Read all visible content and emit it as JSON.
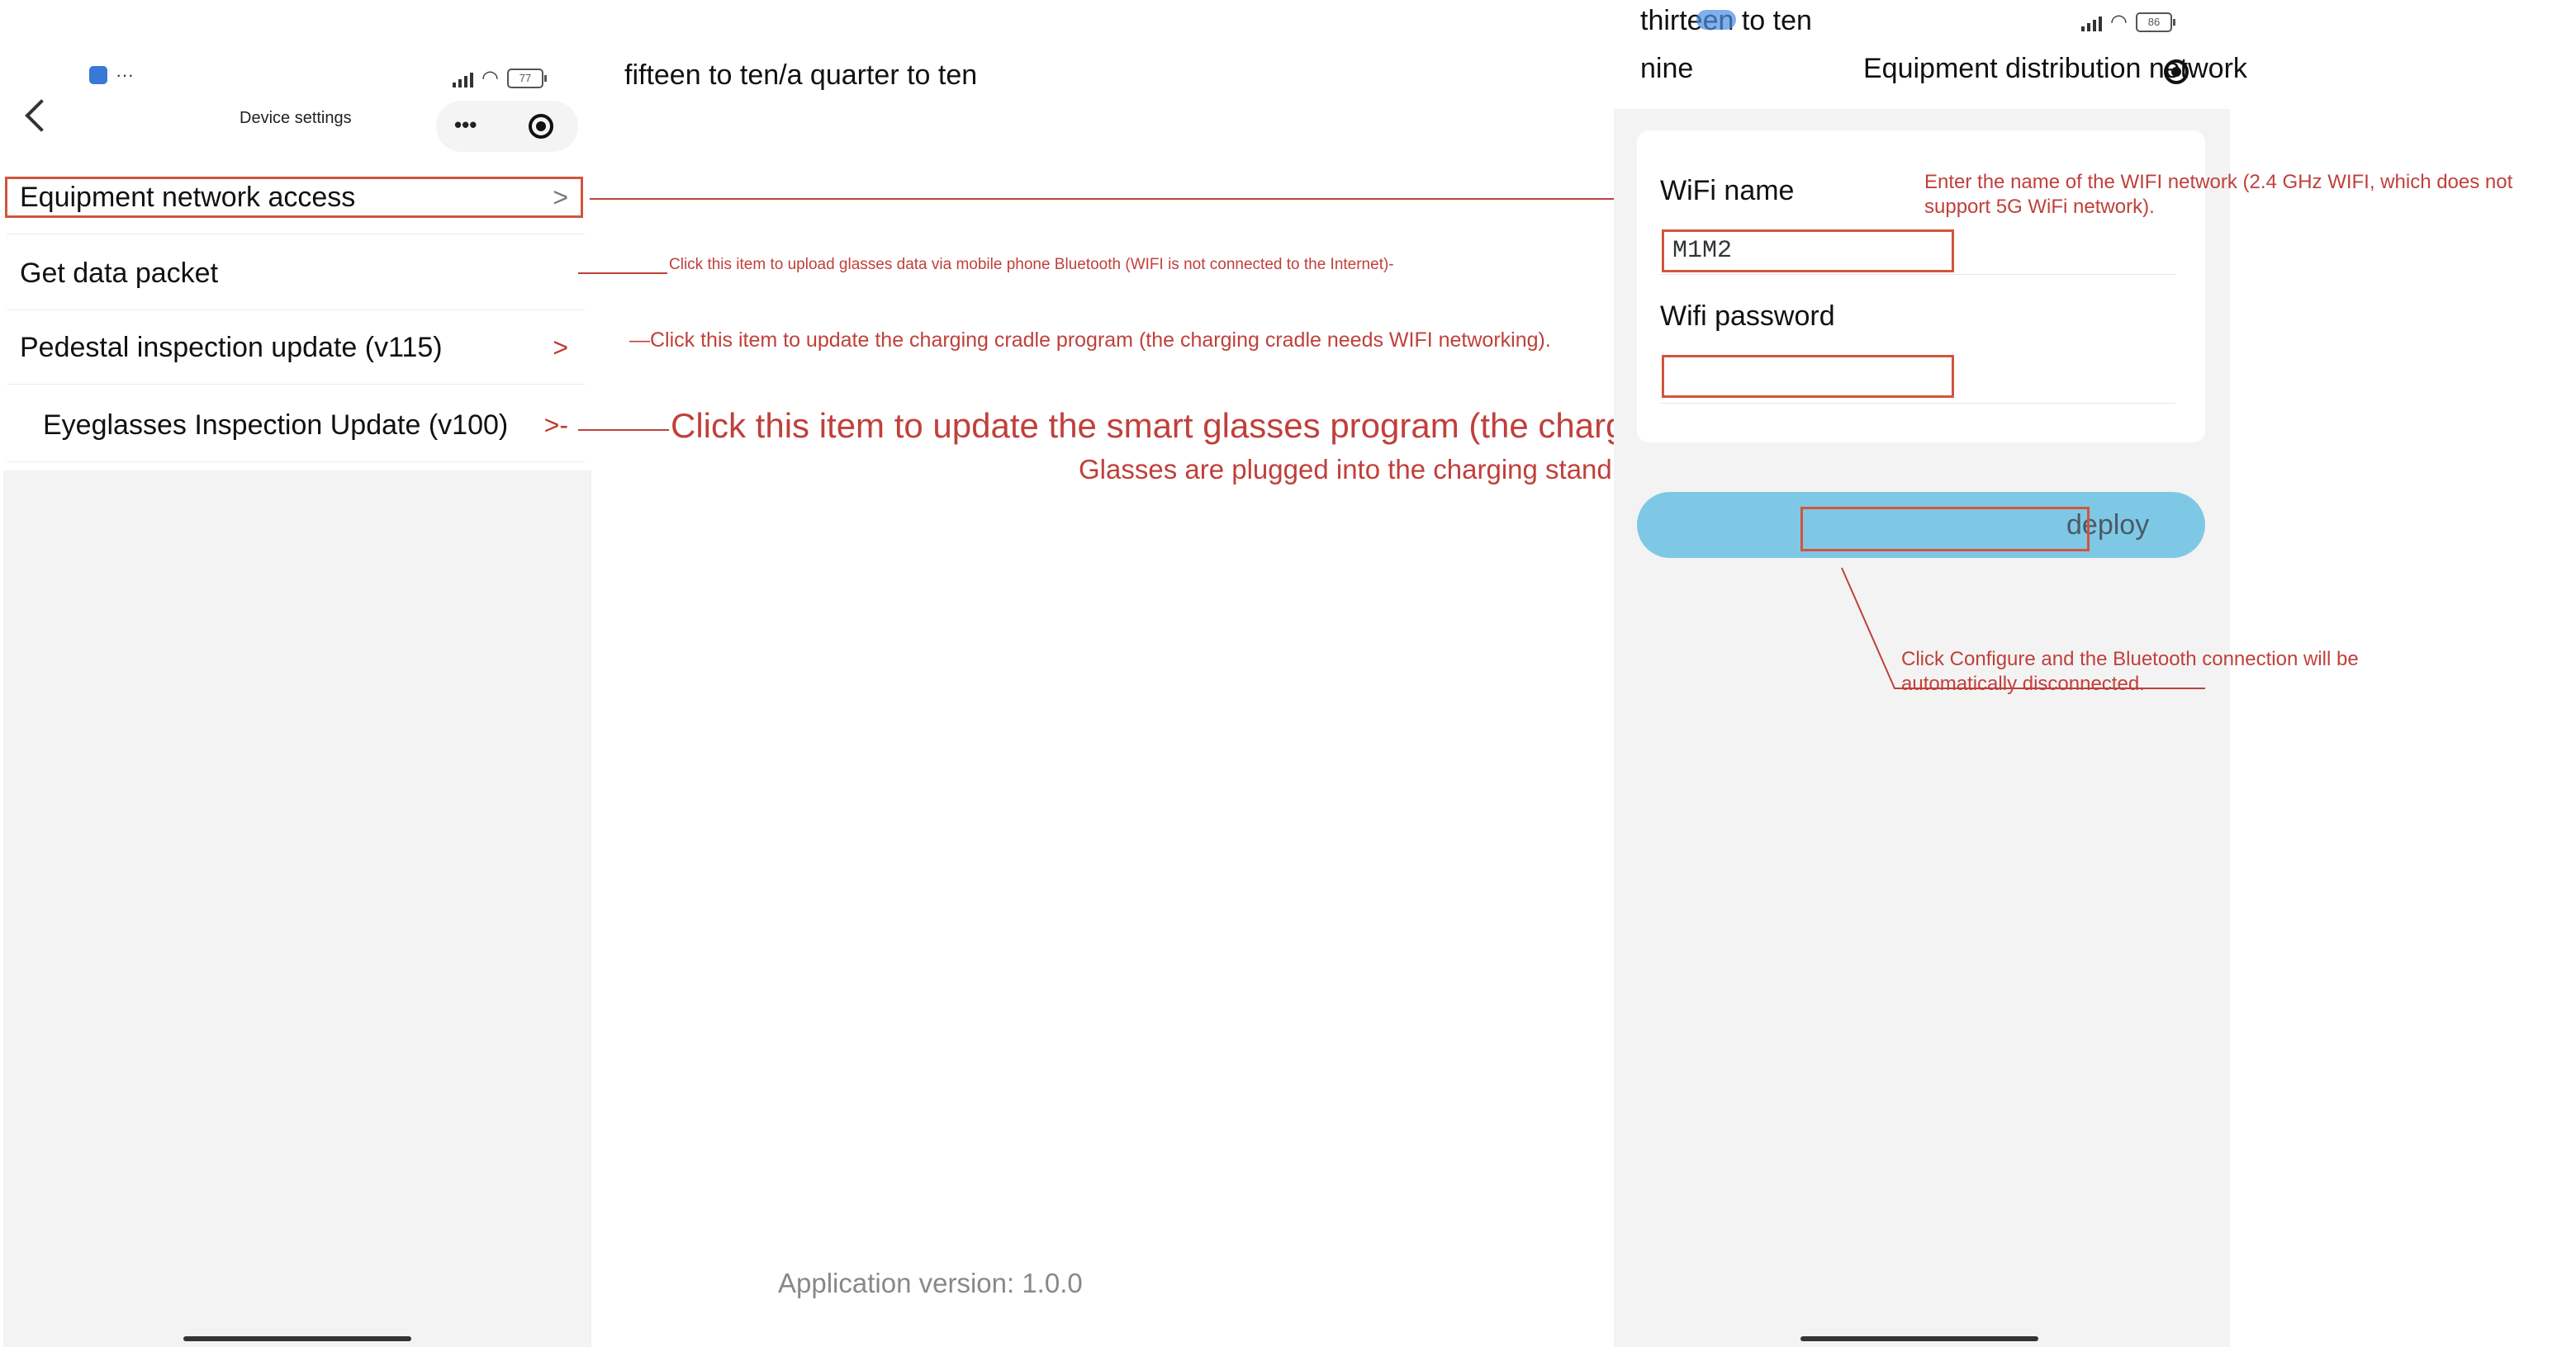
{
  "left_phone": {
    "status": {
      "app_dots": "···",
      "battery": "77"
    },
    "header": {
      "title": "Device settings",
      "more": "•••"
    },
    "menu": [
      {
        "label": "Equipment network access",
        "chevron": ">"
      },
      {
        "label": "Get data packet",
        "chevron": ""
      },
      {
        "label": "Pedestal inspection update (v115)",
        "chevron": ">"
      },
      {
        "label": "Eyeglasses Inspection Update (v100)",
        "chevron": ">-"
      }
    ]
  },
  "time_text_left": "fifteen to ten/a quarter to ten",
  "annotations": {
    "get_data": "Click this item to upload glasses data via mobile phone Bluetooth (WIFI is not connected to the Internet)-",
    "pedestal": "—Click this item to update the charging cradle program (the charging cradle needs WIFI networking).",
    "eyeglasses_line1": "Click this item to update the smart glasses program (the charging stand needs WIFI networking).",
    "eyeglasses_line2": "Glasses are plugged into the charging stand to upgrade.",
    "wifi_name_hint": "Enter the name of the WIFI network (2.4 GHz WIFI, which does not support 5G WiFi network).",
    "deploy_hint": "Click Configure and the Bluetooth connection will be automatically disconnected."
  },
  "footer": {
    "app_version": "Application version: 1.0.0"
  },
  "right_phone": {
    "status": {
      "time_line1": "thirteen to ten",
      "time_line2": "nine",
      "battery": "86"
    },
    "title": "Equipment distribution network",
    "wifi_name_label": "WiFi name",
    "wifi_name_value": "M1M2",
    "wifi_password_label": "Wifi password",
    "wifi_password_value": "",
    "deploy_label": "deploy"
  },
  "colors": {
    "annotation": "#c0403b",
    "deploy_button": "#7ec8e6",
    "phone_bg": "#f3f3f3"
  }
}
